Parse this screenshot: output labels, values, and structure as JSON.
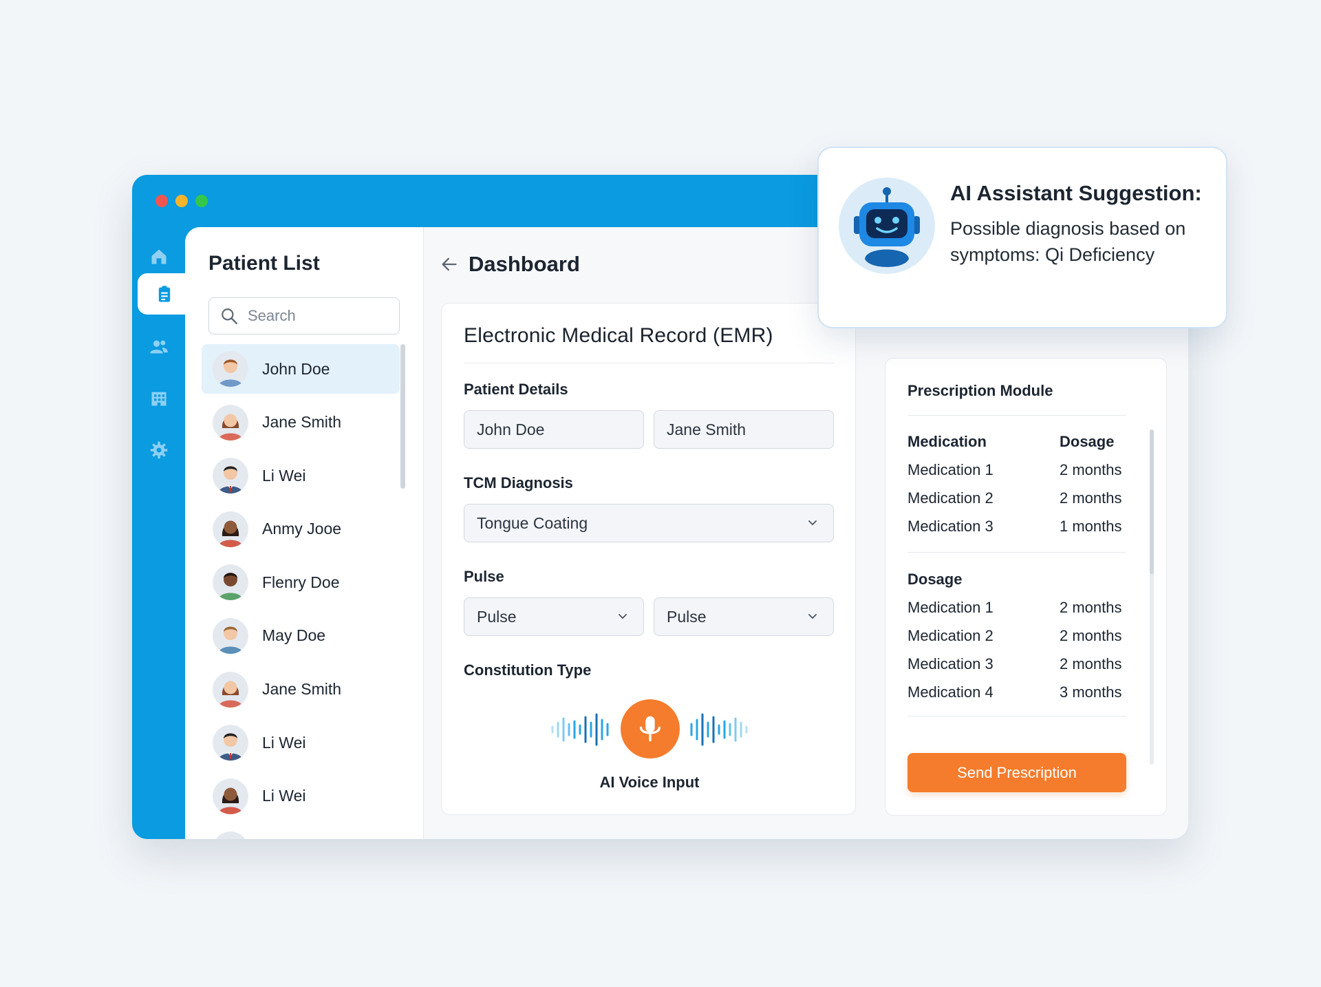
{
  "sidebar": {
    "icons": [
      "home-icon",
      "clipboard-icon",
      "users-icon",
      "building-icon",
      "gear-icon"
    ],
    "active": "clipboard-icon"
  },
  "patient_list": {
    "title": "Patient List",
    "search_placeholder": "Search",
    "patients": [
      {
        "name": "John Doe",
        "selected": true
      },
      {
        "name": "Jane Smith"
      },
      {
        "name": "Li Wei"
      },
      {
        "name": "Anmy Jooe"
      },
      {
        "name": "Flenry Doe"
      },
      {
        "name": "May Doe"
      },
      {
        "name": "Jane Smith"
      },
      {
        "name": "Li Wei"
      },
      {
        "name": "Li Wei"
      }
    ]
  },
  "header": {
    "title": "Dashboard"
  },
  "emr": {
    "title": "Electronic Medical Record (EMR)",
    "patient_details_label": "Patient Details",
    "patient_details": [
      "John Doe",
      "Jane Smith"
    ],
    "tcm_label": "TCM Diagnosis",
    "tcm_value": "Tongue Coating",
    "pulse_label": "Pulse",
    "pulse_values": [
      "Pulse",
      "Pulse"
    ],
    "constitution_label": "Constitution Type",
    "voice_label": "AI Voice Input"
  },
  "prescription": {
    "title": "Prescription Module",
    "table1": {
      "headers": [
        "Medication",
        "Dosage"
      ],
      "rows": [
        [
          "Medication 1",
          "2 months"
        ],
        [
          "Medication 2",
          "2 months"
        ],
        [
          "Medication 3",
          "1 months"
        ]
      ]
    },
    "table2": {
      "header": "Dosage",
      "rows": [
        [
          "Medication 1",
          "2 months"
        ],
        [
          "Medication 2",
          "2 months"
        ],
        [
          "Medication 3",
          "2 months"
        ],
        [
          "Medication 4",
          "3 months"
        ]
      ]
    },
    "send_label": "Send Prescription"
  },
  "ai_suggestion": {
    "title": "AI Assistant Suggestion:",
    "text": "Possible diagnosis based on symptoms: Qi Deficiency"
  },
  "colors": {
    "primary": "#0a9be0",
    "accent": "#f47c2c",
    "selected_row": "#e3f1fb"
  }
}
